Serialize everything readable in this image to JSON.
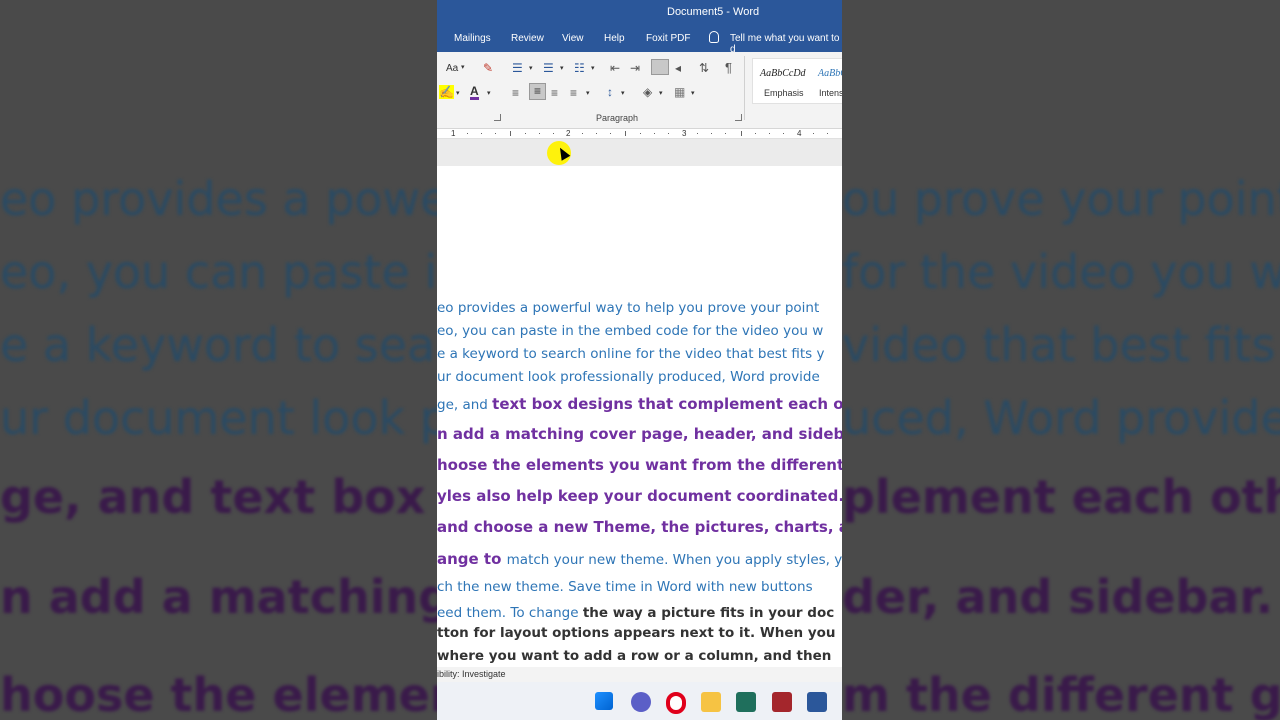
{
  "window": {
    "title": "Document5  -  Word"
  },
  "tabs": [
    "Mailings",
    "Review",
    "View",
    "Help",
    "Foxit PDF"
  ],
  "tell_me": "Tell me what you want to d",
  "ribbon": {
    "font_case_label": "Aa",
    "paragraph_group_label": "Paragraph",
    "styles": [
      {
        "sample": "AaBbCcDd",
        "name": "Emphasis"
      },
      {
        "sample": "AaBbC",
        "name": "Intens"
      }
    ]
  },
  "ruler": {
    "numbers": [
      "1",
      "2",
      "3",
      "4"
    ]
  },
  "document": {
    "lines": [
      {
        "segments": [
          {
            "text": "eo provides a powerful way to help you prove your point",
            "style": "blue"
          }
        ]
      },
      {
        "segments": [
          {
            "text": "eo, you can paste in the embed code for the video you w",
            "style": "blue"
          }
        ]
      },
      {
        "segments": [
          {
            "text": "e a keyword to search online for the video that best fits y",
            "style": "blue"
          }
        ]
      },
      {
        "segments": [
          {
            "text": "ur document look professionally produced, Word provide",
            "style": "blue"
          }
        ]
      },
      {
        "segments": [
          {
            "text": "ge, and ",
            "style": "blue"
          },
          {
            "text": "text box designs that complement each oth",
            "style": "purple"
          }
        ]
      },
      {
        "segments": [
          {
            "text": "n add a matching cover page, header, and sidebar.",
            "style": "purple"
          }
        ]
      },
      {
        "segments": [
          {
            "text": "hoose the elements you want from the different ga",
            "style": "purple"
          }
        ]
      },
      {
        "segments": [
          {
            "text": "yles also help keep your document coordinated. W",
            "style": "purple"
          }
        ]
      },
      {
        "segments": [
          {
            "text": "and choose a new Theme, the pictures, charts, and",
            "style": "purple"
          }
        ]
      },
      {
        "segments": [
          {
            "text": "ange to ",
            "style": "purple"
          },
          {
            "text": "match your new theme. When you apply styles, y",
            "style": "blue"
          }
        ]
      },
      {
        "segments": [
          {
            "text": "ch the new theme. Save time in Word with new buttons",
            "style": "blue"
          }
        ]
      },
      {
        "segments": [
          {
            "text": "eed them. To change ",
            "style": "blue"
          },
          {
            "text": "the way a picture fits in your doc",
            "style": "dark"
          }
        ]
      },
      {
        "segments": [
          {
            "text": "tton for layout options appears next to it. When you",
            "style": "dark"
          }
        ]
      },
      {
        "segments": [
          {
            "text": " where you want to add a row or a column, and then",
            "style": "dark"
          }
        ]
      }
    ]
  },
  "status": {
    "accessibility": "ibility: Investigate"
  },
  "background_lines": [
    {
      "left": "eo provides a powe",
      "right": "ou prove your point",
      "style": "blue"
    },
    {
      "left": "eo, you can paste in",
      "right": "for the video you w",
      "style": "blue"
    },
    {
      "left": "e a keyword to sear",
      "right": "video that best fits y",
      "style": "blue"
    },
    {
      "left": "ur document look p",
      "right": "uced, Word provide",
      "style": "blue"
    },
    {
      "left": "ge, and text box de",
      "right": "plement each oth",
      "style": "purple"
    },
    {
      "left": "n add a matching",
      "right": "der, and sidebar.",
      "style": "purple"
    },
    {
      "left": "hoose the elemen",
      "right": "m the different ga",
      "style": "purple"
    }
  ],
  "taskbar": {
    "icons": [
      "windows-start-icon",
      "teams-chat-icon",
      "opera-browser-icon",
      "file-explorer-icon",
      "terminal-app-icon",
      "access-app-icon",
      "word-app-icon"
    ]
  },
  "colors": {
    "word_blue": "#2b579a",
    "text_blue": "#2e75b6",
    "text_purple": "#7030a0",
    "highlight": "#fff200"
  }
}
